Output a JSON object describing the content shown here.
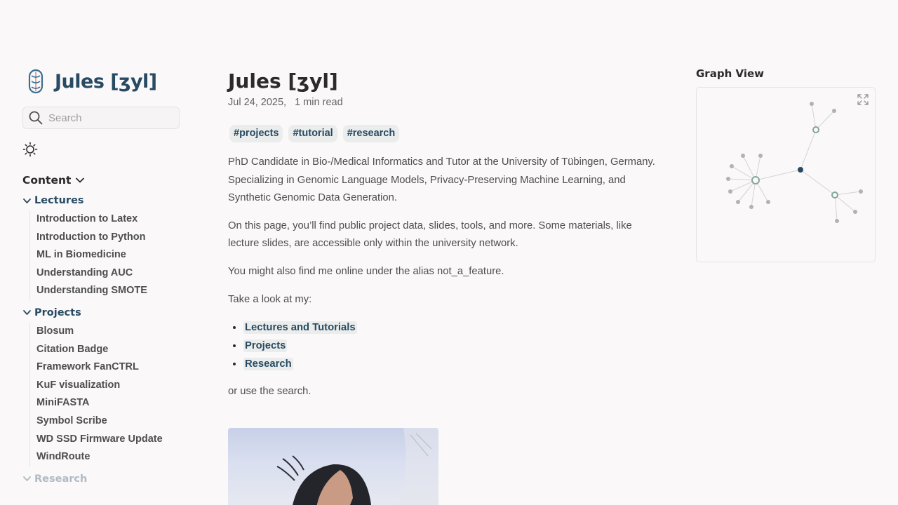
{
  "site": {
    "title": "Jules [ʒyl]"
  },
  "search": {
    "placeholder": "Search"
  },
  "explorer": {
    "title": "Content",
    "folders": [
      {
        "name": "Lectures",
        "items": [
          "Introduction to Latex",
          "Introduction to Python",
          "ML in Biomedicine",
          "Understanding AUC",
          "Understanding SMOTE"
        ]
      },
      {
        "name": "Projects",
        "items": [
          "Blosum",
          "Citation Badge",
          "Framework FanCTRL",
          "KuF visualization",
          "MiniFASTA",
          "Symbol Scribe",
          "WD SSD Firmware Update",
          "WindRoute"
        ]
      },
      {
        "name": "Research",
        "items": []
      }
    ]
  },
  "article": {
    "title": "Jules [ʒyl]",
    "date": "Jul 24, 2025,",
    "read_time": "1 min read",
    "tags": [
      "#projects",
      "#tutorial",
      "#research"
    ],
    "para1": "PhD Candidate in Bio-/Medical Informatics and Tutor at the University of Tübingen, Germany. Specializing in Genomic Language Models, Privacy-Preserving Machine Learning, and Synthetic Genomic Data Generation.",
    "para2": "On this page, you’ll find public project data, slides, tools, and more. Some materials, like lecture slides, are accessible only within the university network.",
    "para3": "You might also find me online under the alias not_a_feature.",
    "para4": "Take a look at my:",
    "links": [
      "Lectures and Tutorials",
      "Projects",
      "Research"
    ],
    "para5": "or use the search."
  },
  "graph": {
    "title": "Graph View"
  },
  "colors": {
    "accent": "#284b63",
    "background": "#faf8f8",
    "graph_node": "#b2b2b2",
    "graph_tag_node": "#84a59d",
    "graph_current_node": "#284b63"
  }
}
